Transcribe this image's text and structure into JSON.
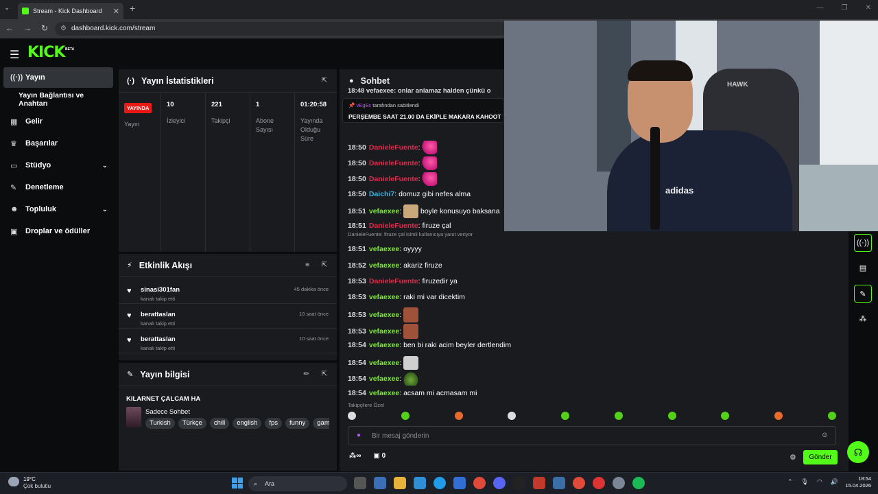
{
  "browser": {
    "tab_title": "Stream - Kick Dashboard",
    "url": "dashboard.kick.com/stream"
  },
  "brand": {
    "logo": "KICK",
    "beta": "BETA"
  },
  "sidebar": {
    "items": [
      {
        "label": "Yayın",
        "icon": "broadcast-icon"
      },
      {
        "label": "Yayın Bağlantısı ve Anahtarı",
        "icon": ""
      },
      {
        "label": "Gelir",
        "icon": "chart-icon"
      },
      {
        "label": "Başarılar",
        "icon": "trophy-icon"
      },
      {
        "label": "Stüdyo",
        "icon": "studio-icon"
      },
      {
        "label": "Denetleme",
        "icon": "wrench-icon"
      },
      {
        "label": "Topluluk",
        "icon": "community-icon"
      },
      {
        "label": "Droplar ve ödüller",
        "icon": "gift-icon"
      }
    ]
  },
  "stats": {
    "title": "Yayın İstatistikleri",
    "badge": "YAYINDA",
    "status_label": "Yayın",
    "viewers_value": "10",
    "viewers_label": "İzleyici",
    "followers_value": "221",
    "followers_label": "Takipçi",
    "subs_value": "1",
    "subs_label": "Abone Sayısı",
    "duration_value": "01:20:58",
    "duration_label": "Yayında Olduğu Süre"
  },
  "activity": {
    "title": "Etkinlik Akışı",
    "items": [
      {
        "name": "sinasi301fan",
        "sub": "kanalı takip etti",
        "time": "45 dakika önce"
      },
      {
        "name": "berattaslan",
        "sub": "kanalı takip etti",
        "time": "10 saat önce"
      },
      {
        "name": "berattaslan",
        "sub": "kanalı takip etti",
        "time": "10 saat önce"
      }
    ]
  },
  "info": {
    "title": "Yayın bilgisi",
    "stream_title": "KILARNET ÇALCAM HA",
    "category": "Sadece Sohbet",
    "tags": [
      "Turkish",
      "Türkçe",
      "chill",
      "english",
      "fps",
      "funny",
      "gaming"
    ]
  },
  "chat": {
    "title": "Sohbet",
    "top_partial": "18:48 vefaexee: onlar anlamaz halden çünkü o",
    "pinned_by_user": "vEgEc",
    "pinned_by_suffix": "tarafından sabitlendi",
    "pinned_msg": "PERŞEMBE SAAT 21.00 DA EKİPLE MAKARA KAHOOT",
    "reply_note": "DanieleFuente: firuze çal isimli kullanıcıya yanıt veriyor",
    "messages": [
      {
        "time": "18:50",
        "user": "DanieleFuente",
        "text": "",
        "emote": "pink"
      },
      {
        "time": "18:50",
        "user": "DanieleFuente",
        "text": "",
        "emote": "pink"
      },
      {
        "time": "18:50",
        "user": "DanieleFuente",
        "text": "",
        "emote": "pink"
      },
      {
        "time": "18:50",
        "user": "Daichi7",
        "text": "domuz gibi nefes alma",
        "emote": ""
      },
      {
        "time": "18:51",
        "user": "vefaexee",
        "text": "boyle konusuyo baksana",
        "emote": "cat"
      },
      {
        "time": "18:51",
        "user": "DanieleFuente",
        "text": "firuze çal",
        "emote": ""
      },
      {
        "time": "18:51",
        "user": "vefaexee",
        "text": "oyyyy",
        "emote": ""
      },
      {
        "time": "18:52",
        "user": "vefaexee",
        "text": "akariz firuze",
        "emote": ""
      },
      {
        "time": "18:53",
        "user": "DanieleFuente",
        "text": "firuzedir ya",
        "emote": ""
      },
      {
        "time": "18:53",
        "user": "vefaexee",
        "text": "raki mi var dicektim",
        "emote": ""
      },
      {
        "time": "18:53",
        "user": "vefaexee",
        "text": "",
        "emote": "face"
      },
      {
        "time": "18:53",
        "user": "vefaexee",
        "text": "",
        "emote": "face"
      },
      {
        "time": "18:54",
        "user": "vefaexee",
        "text": "ben bi raki acim beyler dertlendim",
        "emote": ""
      },
      {
        "time": "18:54",
        "user": "vefaexee",
        "text": "",
        "emote": "cat2"
      },
      {
        "time": "18:54",
        "user": "vefaexee",
        "text": "",
        "emote": "frog"
      },
      {
        "time": "18:54",
        "user": "vefaexee",
        "text": "acsam mi acmasam mi",
        "emote": ""
      }
    ],
    "followers_only": "Takipçilere Özel",
    "placeholder": "Bir mesaj gönderin",
    "points": "0",
    "send": "Gönder"
  },
  "webcam": {
    "chair_brand": "HAWK",
    "shirt_text": "adidas"
  },
  "taskbar": {
    "temp": "19°C",
    "weather": "Çok bulutlu",
    "search": "Ara",
    "time": "18:54",
    "date": "15.04.2026"
  },
  "colors": {
    "accent": "#53fc18",
    "live": "#e91916",
    "panel": "#191b1f",
    "bg": "#0b0c0e"
  }
}
